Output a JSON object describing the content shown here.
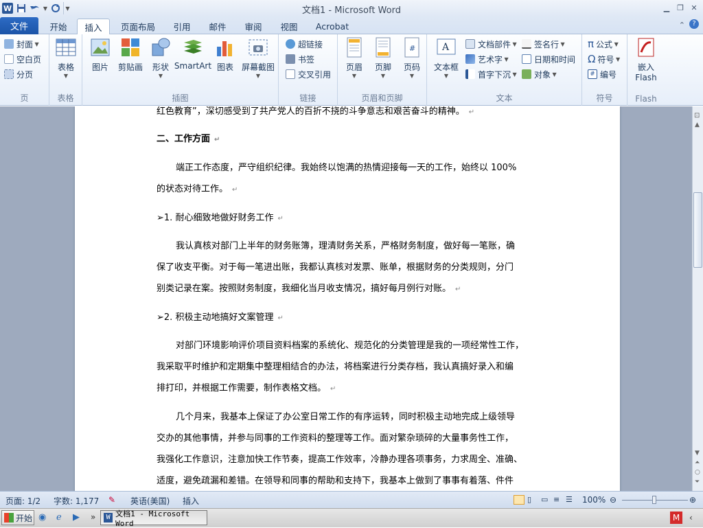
{
  "window": {
    "title": "文档1 - Microsoft Word"
  },
  "tabs": {
    "file": "文件",
    "home": "开始",
    "insert": "插入",
    "layout": "页面布局",
    "references": "引用",
    "mailings": "邮件",
    "review": "审阅",
    "view": "视图",
    "acrobat": "Acrobat"
  },
  "ribbon": {
    "pages": {
      "cover": "封面",
      "blank": "空白页",
      "break": "分页",
      "label": "页"
    },
    "tables": {
      "table": "表格",
      "label": "表格"
    },
    "illustrations": {
      "picture": "图片",
      "clipart": "剪贴画",
      "shapes": "形状",
      "smartart": "SmartArt",
      "chart": "图表",
      "screenshot": "屏幕截图",
      "label": "插图"
    },
    "links": {
      "hyperlink": "超链接",
      "bookmark": "书签",
      "crossref": "交叉引用",
      "label": "链接"
    },
    "header_footer": {
      "header": "页眉",
      "footer": "页脚",
      "pagenum": "页码",
      "label": "页眉和页脚"
    },
    "text": {
      "textbox": "文本框",
      "quickparts": "文档部件",
      "wordart": "艺术字",
      "dropcap": "首字下沉",
      "signature": "签名行",
      "datetime": "日期和时间",
      "object": "对象",
      "label": "文本"
    },
    "symbols": {
      "equation": "公式",
      "symbol": "符号",
      "number": "编号",
      "label": "符号"
    },
    "flash": {
      "embed_line1": "嵌入",
      "embed_line2": "Flash",
      "label": "Flash"
    }
  },
  "document": {
    "cut_line": "红色教育”，深切感受到了共产党人的百折不挠的斗争意志和艰苦奋斗的精神。",
    "heading2": "二、工作方面",
    "p1_line1": "端正工作态度，严守组织纪律。我始终以饱满的热情迎接每一天的工作，始终以 100%",
    "p1_line2": "的状态对待工作。",
    "sub1": "1. 耐心细致地做好财务工作",
    "p2_line1": "我认真核对部门上半年的财务账簿，理清财务关系，严格财务制度，做好每一笔账，确",
    "p2_line2": "保了收支平衡。对于每一笔进出账，我都认真核对发票、账单，根据财务的分类规则，分门",
    "p2_line3": "别类记录在案。按照财务制度，我细化当月收支情况，搞好每月例行对账。",
    "sub2": "2. 积极主动地搞好文案管理",
    "p3_line1": "对部门环境影响评价项目资料档案的系统化、规范化的分类管理是我的一项经常性工作，",
    "p3_line2": "我采取平时维护和定期集中整理相结合的办法，将档案进行分类存档，我认真搞好录入和编",
    "p3_line3": "排打印，并根据工作需要，制作表格文档。",
    "p4_line1": "几个月来，我基本上保证了办公室日常工作的有序运转，同时积极主动地完成上级领导",
    "p4_line2": "交办的其他事情，并参与同事的工作资料的整理等工作。面对繁杂琐碎的大量事务性工作，",
    "p4_line3": "我强化工作意识，注意加快工作节奏，提高工作效率，冷静办理各项事务，力求周全、准确、",
    "p4_line4": "适度，避免疏漏和差错。在领导和同事的帮助和支持下，我基本上做到了事事有着落、件件"
  },
  "status": {
    "page": "页面: 1/2",
    "words": "字数: 1,177",
    "language": "英语(美国)",
    "mode": "插入",
    "zoom": "100%"
  },
  "taskbar": {
    "start": "开始",
    "task": "文档1 - Microsoft Word"
  },
  "colors": {
    "accent": "#2b5797",
    "file_tab": "#1b54a8",
    "doc_bg": "#9eaabe"
  }
}
